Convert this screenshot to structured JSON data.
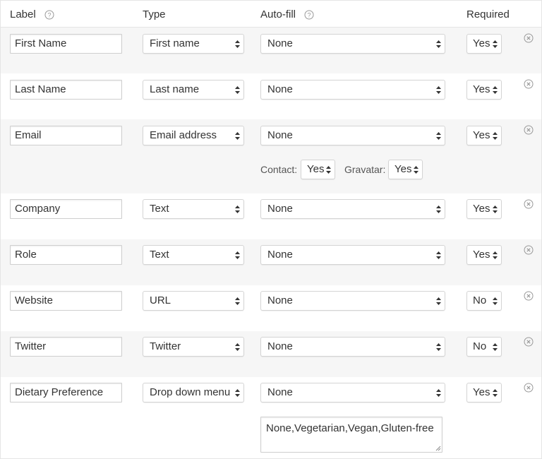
{
  "header": {
    "label": "Label",
    "type": "Type",
    "autofill": "Auto-fill",
    "required": "Required"
  },
  "rows": [
    {
      "label": "First Name",
      "type": "First name",
      "autofill": "None",
      "required": "Yes"
    },
    {
      "label": "Last Name",
      "type": "Last name",
      "autofill": "None",
      "required": "Yes"
    },
    {
      "label": "Email",
      "type": "Email address",
      "autofill": "None",
      "required": "Yes",
      "extras": {
        "contact_label": "Contact:",
        "contact_value": "Yes",
        "gravatar_label": "Gravatar:",
        "gravatar_value": "Yes"
      }
    },
    {
      "label": "Company",
      "type": "Text",
      "autofill": "None",
      "required": "Yes"
    },
    {
      "label": "Role",
      "type": "Text",
      "autofill": "None",
      "required": "Yes"
    },
    {
      "label": "Website",
      "type": "URL",
      "autofill": "None",
      "required": "No"
    },
    {
      "label": "Twitter",
      "type": "Twitter",
      "autofill": "None",
      "required": "No"
    },
    {
      "label": "Dietary Preference",
      "type": "Drop down menu",
      "autofill": "None",
      "required": "Yes",
      "options_text": "None,Vegetarian,Vegan,Gluten-free"
    }
  ],
  "icons": {
    "help": "help-circle-icon",
    "remove": "remove-circle-icon",
    "select_arrows": "select-arrows-icon"
  },
  "colors": {
    "row_alt_bg": "#f6f6f6",
    "border": "#cfcfcf",
    "text": "#333333",
    "icon": "#999999"
  }
}
